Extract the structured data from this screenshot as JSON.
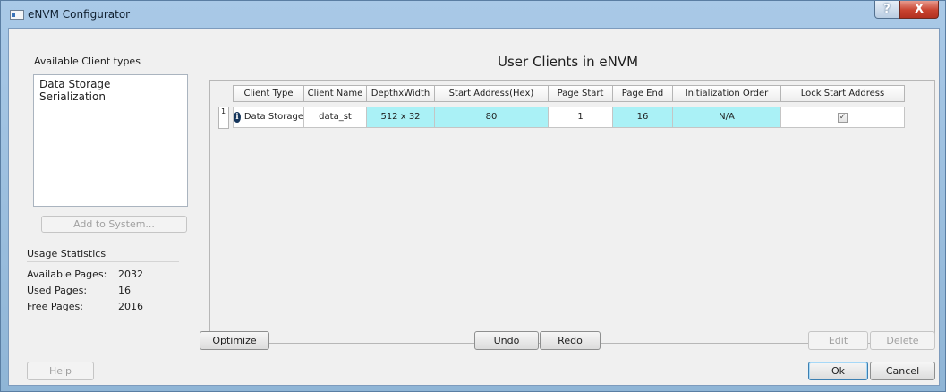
{
  "window": {
    "title": "eNVM Configurator",
    "help_glyph": "?",
    "close_glyph": "X"
  },
  "left_panel": {
    "available_types_label": "Available Client types",
    "types": [
      "Data Storage",
      "Serialization"
    ],
    "add_button": "Add to System...",
    "usage_label": "Usage Statistics",
    "stats": [
      {
        "label": "Available Pages:",
        "value": "2032"
      },
      {
        "label": "Used Pages:",
        "value": "16"
      },
      {
        "label": "Free Pages:",
        "value": "2016"
      }
    ]
  },
  "main": {
    "title": "User Clients in eNVM",
    "columns": [
      "Client Type",
      "Client Name",
      "DepthxWidth",
      "Start Address(Hex)",
      "Page Start",
      "Page End",
      "Initialization Order",
      "Lock Start Address"
    ],
    "rows": [
      {
        "row_number": "1",
        "client_type": "Data Storage",
        "client_name": "data_st",
        "depth_width": "512 x 32",
        "start_address": "80",
        "page_start": "1",
        "page_end": "16",
        "init_order": "N/A",
        "lock_start_address": "✓"
      }
    ]
  },
  "buttons": {
    "optimize": "Optimize",
    "undo": "Undo",
    "redo": "Redo",
    "edit": "Edit",
    "delete": "Delete",
    "help": "Help",
    "ok": "Ok",
    "cancel": "Cancel"
  },
  "colors": {
    "highlight_cell": "#aaf1f6",
    "close_button": "#c8432f"
  }
}
